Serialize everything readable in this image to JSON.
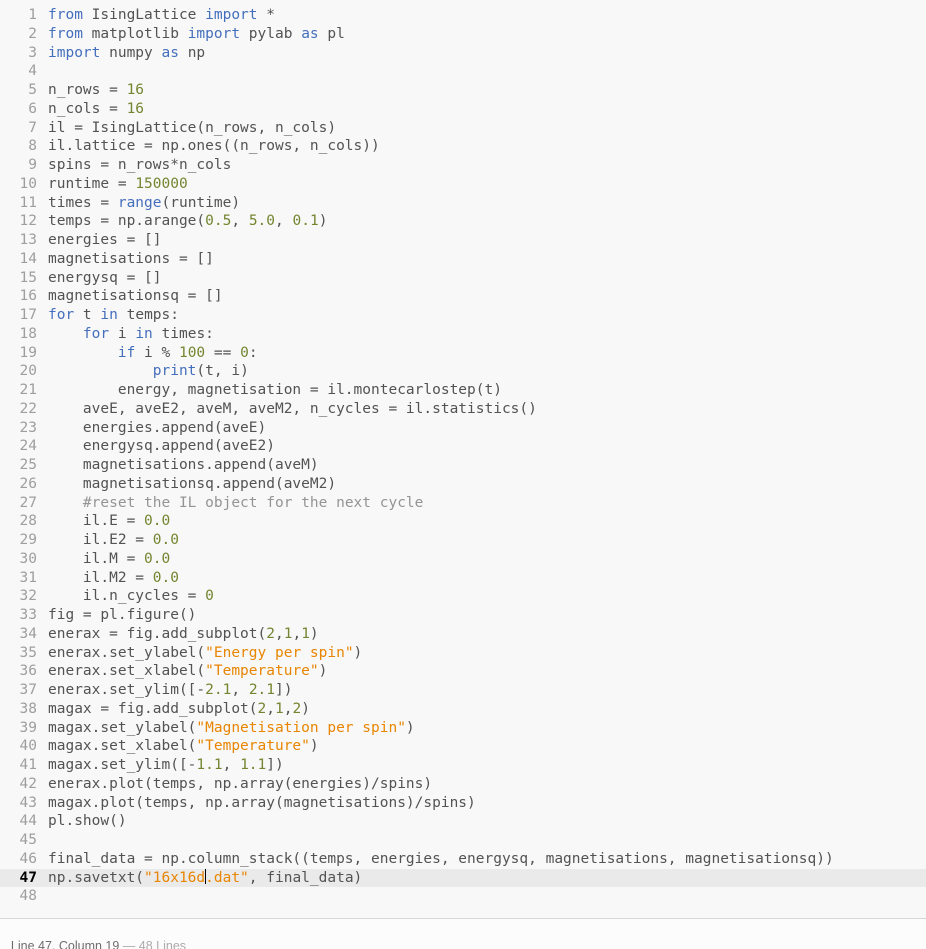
{
  "editor": {
    "language": "python",
    "colors": {
      "background": "#f8f8f8",
      "active_line_background": "#eaeaea",
      "text": "#535353",
      "keyword": "#446fbd",
      "number": "#738530",
      "string": "#e88501",
      "comment": "#949494",
      "gutter": "#9e9e9e",
      "gutter_active": "#000000"
    },
    "cursor": {
      "line": 47,
      "column": 19
    },
    "lines": [
      {
        "n": 1,
        "t": [
          [
            "k",
            "from"
          ],
          [
            "d",
            " IsingLattice "
          ],
          [
            "k",
            "import"
          ],
          [
            "d",
            " *"
          ]
        ]
      },
      {
        "n": 2,
        "t": [
          [
            "k",
            "from"
          ],
          [
            "d",
            " matplotlib "
          ],
          [
            "k",
            "import"
          ],
          [
            "d",
            " pylab "
          ],
          [
            "k",
            "as"
          ],
          [
            "d",
            " pl"
          ]
        ]
      },
      {
        "n": 3,
        "t": [
          [
            "k",
            "import"
          ],
          [
            "d",
            " numpy "
          ],
          [
            "k",
            "as"
          ],
          [
            "d",
            " np"
          ]
        ]
      },
      {
        "n": 4,
        "t": []
      },
      {
        "n": 5,
        "t": [
          [
            "d",
            "n_rows = "
          ],
          [
            "n",
            "16"
          ]
        ]
      },
      {
        "n": 6,
        "t": [
          [
            "d",
            "n_cols = "
          ],
          [
            "n",
            "16"
          ]
        ]
      },
      {
        "n": 7,
        "t": [
          [
            "d",
            "il = IsingLattice(n_rows, n_cols)"
          ]
        ]
      },
      {
        "n": 8,
        "t": [
          [
            "d",
            "il.lattice = np.ones((n_rows, n_cols))"
          ]
        ]
      },
      {
        "n": 9,
        "t": [
          [
            "d",
            "spins = n_rows*n_cols"
          ]
        ]
      },
      {
        "n": 10,
        "t": [
          [
            "d",
            "runtime = "
          ],
          [
            "n",
            "150000"
          ]
        ]
      },
      {
        "n": 11,
        "t": [
          [
            "d",
            "times = "
          ],
          [
            "k",
            "range"
          ],
          [
            "d",
            "(runtime)"
          ]
        ]
      },
      {
        "n": 12,
        "t": [
          [
            "d",
            "temps = np.arange("
          ],
          [
            "n",
            "0.5"
          ],
          [
            "d",
            ", "
          ],
          [
            "n",
            "5.0"
          ],
          [
            "d",
            ", "
          ],
          [
            "n",
            "0.1"
          ],
          [
            "d",
            ")"
          ]
        ]
      },
      {
        "n": 13,
        "t": [
          [
            "d",
            "energies = []"
          ]
        ]
      },
      {
        "n": 14,
        "t": [
          [
            "d",
            "magnetisations = []"
          ]
        ]
      },
      {
        "n": 15,
        "t": [
          [
            "d",
            "energysq = []"
          ]
        ]
      },
      {
        "n": 16,
        "t": [
          [
            "d",
            "magnetisationsq = []"
          ]
        ]
      },
      {
        "n": 17,
        "t": [
          [
            "k",
            "for"
          ],
          [
            "d",
            " t "
          ],
          [
            "k",
            "in"
          ],
          [
            "d",
            " temps:"
          ]
        ]
      },
      {
        "n": 18,
        "t": [
          [
            "d",
            "    "
          ],
          [
            "k",
            "for"
          ],
          [
            "d",
            " i "
          ],
          [
            "k",
            "in"
          ],
          [
            "d",
            " times:"
          ]
        ]
      },
      {
        "n": 19,
        "t": [
          [
            "d",
            "        "
          ],
          [
            "k",
            "if"
          ],
          [
            "d",
            " i % "
          ],
          [
            "n",
            "100"
          ],
          [
            "d",
            " == "
          ],
          [
            "n",
            "0"
          ],
          [
            "d",
            ":"
          ]
        ]
      },
      {
        "n": 20,
        "t": [
          [
            "d",
            "            "
          ],
          [
            "k",
            "print"
          ],
          [
            "d",
            "(t, i)"
          ]
        ]
      },
      {
        "n": 21,
        "t": [
          [
            "d",
            "        energy, magnetisation = il.montecarlostep(t)"
          ]
        ]
      },
      {
        "n": 22,
        "t": [
          [
            "d",
            "    aveE, aveE2, aveM, aveM2, n_cycles = il.statistics()"
          ]
        ]
      },
      {
        "n": 23,
        "t": [
          [
            "d",
            "    energies.append(aveE)"
          ]
        ]
      },
      {
        "n": 24,
        "t": [
          [
            "d",
            "    energysq.append(aveE2)"
          ]
        ]
      },
      {
        "n": 25,
        "t": [
          [
            "d",
            "    magnetisations.append(aveM)"
          ]
        ]
      },
      {
        "n": 26,
        "t": [
          [
            "d",
            "    magnetisationsq.append(aveM2)"
          ]
        ]
      },
      {
        "n": 27,
        "t": [
          [
            "d",
            "    "
          ],
          [
            "c",
            "#reset the IL object for the next cycle"
          ]
        ]
      },
      {
        "n": 28,
        "t": [
          [
            "d",
            "    il.E = "
          ],
          [
            "n",
            "0.0"
          ]
        ]
      },
      {
        "n": 29,
        "t": [
          [
            "d",
            "    il.E2 = "
          ],
          [
            "n",
            "0.0"
          ]
        ]
      },
      {
        "n": 30,
        "t": [
          [
            "d",
            "    il.M = "
          ],
          [
            "n",
            "0.0"
          ]
        ]
      },
      {
        "n": 31,
        "t": [
          [
            "d",
            "    il.M2 = "
          ],
          [
            "n",
            "0.0"
          ]
        ]
      },
      {
        "n": 32,
        "t": [
          [
            "d",
            "    il.n_cycles = "
          ],
          [
            "n",
            "0"
          ]
        ]
      },
      {
        "n": 33,
        "t": [
          [
            "d",
            "fig = pl.figure()"
          ]
        ]
      },
      {
        "n": 34,
        "t": [
          [
            "d",
            "enerax = fig.add_subplot("
          ],
          [
            "n",
            "2"
          ],
          [
            "d",
            ","
          ],
          [
            "n",
            "1"
          ],
          [
            "d",
            ","
          ],
          [
            "n",
            "1"
          ],
          [
            "d",
            ")"
          ]
        ]
      },
      {
        "n": 35,
        "t": [
          [
            "d",
            "enerax.set_ylabel("
          ],
          [
            "s",
            "\"Energy per spin\""
          ],
          [
            "d",
            ")"
          ]
        ]
      },
      {
        "n": 36,
        "t": [
          [
            "d",
            "enerax.set_xlabel("
          ],
          [
            "s",
            "\"Temperature\""
          ],
          [
            "d",
            ")"
          ]
        ]
      },
      {
        "n": 37,
        "t": [
          [
            "d",
            "enerax.set_ylim([-"
          ],
          [
            "n",
            "2.1"
          ],
          [
            "d",
            ", "
          ],
          [
            "n",
            "2.1"
          ],
          [
            "d",
            "])"
          ]
        ]
      },
      {
        "n": 38,
        "t": [
          [
            "d",
            "magax = fig.add_subplot("
          ],
          [
            "n",
            "2"
          ],
          [
            "d",
            ","
          ],
          [
            "n",
            "1"
          ],
          [
            "d",
            ","
          ],
          [
            "n",
            "2"
          ],
          [
            "d",
            ")"
          ]
        ]
      },
      {
        "n": 39,
        "t": [
          [
            "d",
            "magax.set_ylabel("
          ],
          [
            "s",
            "\"Magnetisation per spin\""
          ],
          [
            "d",
            ")"
          ]
        ]
      },
      {
        "n": 40,
        "t": [
          [
            "d",
            "magax.set_xlabel("
          ],
          [
            "s",
            "\"Temperature\""
          ],
          [
            "d",
            ")"
          ]
        ]
      },
      {
        "n": 41,
        "t": [
          [
            "d",
            "magax.set_ylim([-"
          ],
          [
            "n",
            "1.1"
          ],
          [
            "d",
            ", "
          ],
          [
            "n",
            "1.1"
          ],
          [
            "d",
            "])"
          ]
        ]
      },
      {
        "n": 42,
        "t": [
          [
            "d",
            "enerax.plot(temps, np.array(energies)/spins)"
          ]
        ]
      },
      {
        "n": 43,
        "t": [
          [
            "d",
            "magax.plot(temps, np.array(magnetisations)/spins)"
          ]
        ]
      },
      {
        "n": 44,
        "t": [
          [
            "d",
            "pl.show()"
          ]
        ]
      },
      {
        "n": 45,
        "t": []
      },
      {
        "n": 46,
        "t": [
          [
            "d",
            "final_data = np.column_stack((temps, energies, energysq, magnetisations, magnetisationsq))"
          ]
        ]
      },
      {
        "n": 47,
        "t": [
          [
            "d",
            "np.savetxt("
          ],
          [
            "s",
            "\"16x16d"
          ],
          [
            "caret",
            ""
          ],
          [
            "s",
            ".dat\""
          ],
          [
            "d",
            ", final_data)"
          ]
        ]
      },
      {
        "n": 48,
        "t": []
      }
    ]
  },
  "status_bar": {
    "position": "Line 47, Column 19",
    "separator": " — ",
    "line_count": "48 Lines"
  }
}
